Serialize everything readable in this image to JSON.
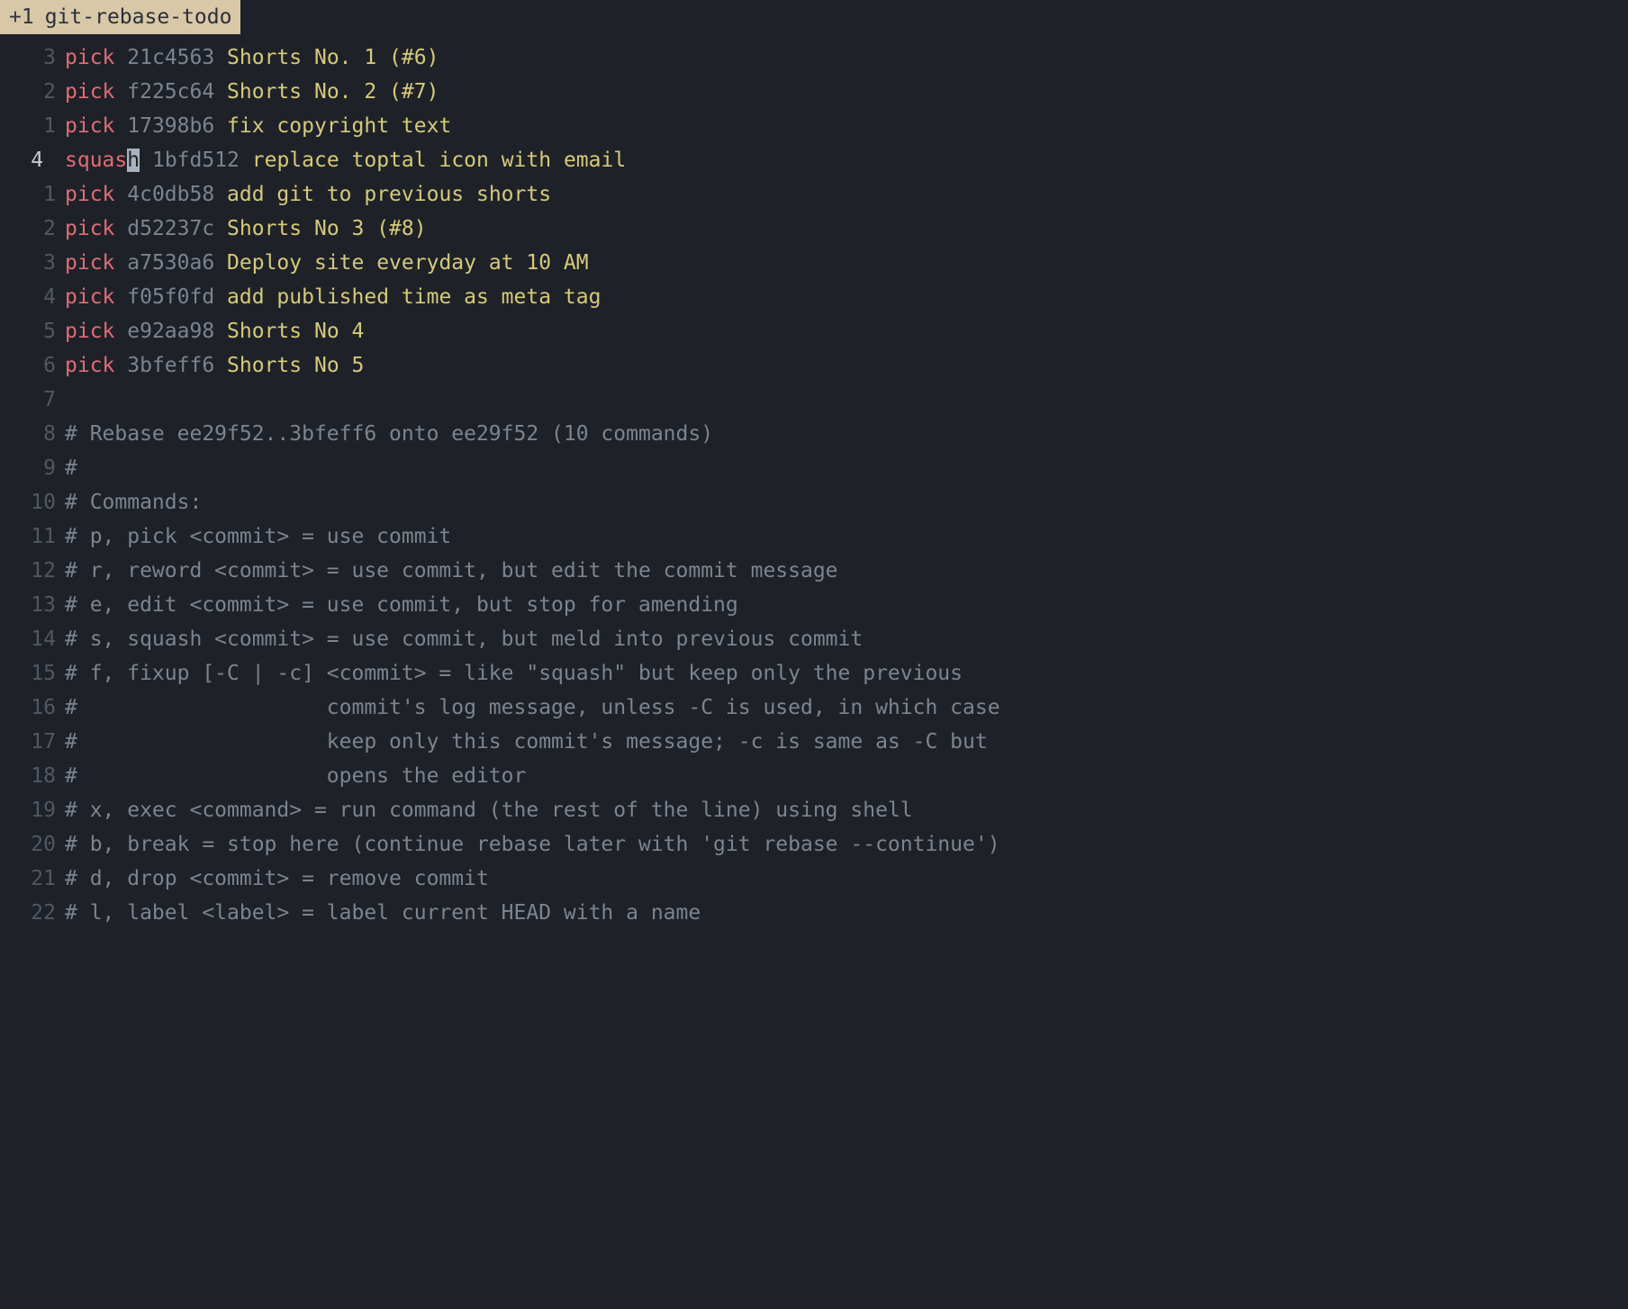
{
  "tab": {
    "indicator": "+1",
    "filename": "git-rebase-todo"
  },
  "cursor_line_abs": "4",
  "lines": [
    {
      "ln": "3",
      "kind": "commit",
      "cmd": "pick",
      "hash": "21c4563",
      "msg": "Shorts No. 1 (#6)"
    },
    {
      "ln": "2",
      "kind": "commit",
      "cmd": "pick",
      "hash": "f225c64",
      "msg": "Shorts No. 2 (#7)"
    },
    {
      "ln": "1",
      "kind": "commit",
      "cmd": "pick",
      "hash": "17398b6",
      "msg": "fix copyright text"
    },
    {
      "ln": "4 ",
      "kind": "commit_cursor",
      "cmd_pre": "squas",
      "cmd_cur": "h",
      "hash": "1bfd512",
      "msg": "replace toptal icon with email"
    },
    {
      "ln": "1",
      "kind": "commit",
      "cmd": "pick",
      "hash": "4c0db58",
      "msg": "add git to previous shorts"
    },
    {
      "ln": "2",
      "kind": "commit",
      "cmd": "pick",
      "hash": "d52237c",
      "msg": "Shorts No 3 (#8)"
    },
    {
      "ln": "3",
      "kind": "commit",
      "cmd": "pick",
      "hash": "a7530a6",
      "msg": "Deploy site everyday at 10 AM"
    },
    {
      "ln": "4",
      "kind": "commit",
      "cmd": "pick",
      "hash": "f05f0fd",
      "msg": "add published time as meta tag"
    },
    {
      "ln": "5",
      "kind": "commit",
      "cmd": "pick",
      "hash": "e92aa98",
      "msg": "Shorts No 4"
    },
    {
      "ln": "6",
      "kind": "commit",
      "cmd": "pick",
      "hash": "3bfeff6",
      "msg": "Shorts No 5"
    },
    {
      "ln": "7",
      "kind": "blank"
    },
    {
      "ln": "8",
      "kind": "comment",
      "text": "# Rebase ee29f52..3bfeff6 onto ee29f52 (10 commands)"
    },
    {
      "ln": "9",
      "kind": "comment",
      "text": "#"
    },
    {
      "ln": "10",
      "kind": "comment",
      "text": "# Commands:"
    },
    {
      "ln": "11",
      "kind": "comment",
      "text": "# p, pick <commit> = use commit"
    },
    {
      "ln": "12",
      "kind": "comment",
      "text": "# r, reword <commit> = use commit, but edit the commit message"
    },
    {
      "ln": "13",
      "kind": "comment",
      "text": "# e, edit <commit> = use commit, but stop for amending"
    },
    {
      "ln": "14",
      "kind": "comment",
      "text": "# s, squash <commit> = use commit, but meld into previous commit"
    },
    {
      "ln": "15",
      "kind": "comment",
      "text": "# f, fixup [-C | -c] <commit> = like \"squash\" but keep only the previous"
    },
    {
      "ln": "16",
      "kind": "comment",
      "text": "#                    commit's log message, unless -C is used, in which case"
    },
    {
      "ln": "17",
      "kind": "comment",
      "text": "#                    keep only this commit's message; -c is same as -C but"
    },
    {
      "ln": "18",
      "kind": "comment",
      "text": "#                    opens the editor"
    },
    {
      "ln": "19",
      "kind": "comment",
      "text": "# x, exec <command> = run command (the rest of the line) using shell"
    },
    {
      "ln": "20",
      "kind": "comment",
      "text": "# b, break = stop here (continue rebase later with 'git rebase --continue')"
    },
    {
      "ln": "21",
      "kind": "comment",
      "text": "# d, drop <commit> = remove commit"
    },
    {
      "ln": "22",
      "kind": "comment",
      "text": "# l, label <label> = label current HEAD with a name"
    }
  ]
}
